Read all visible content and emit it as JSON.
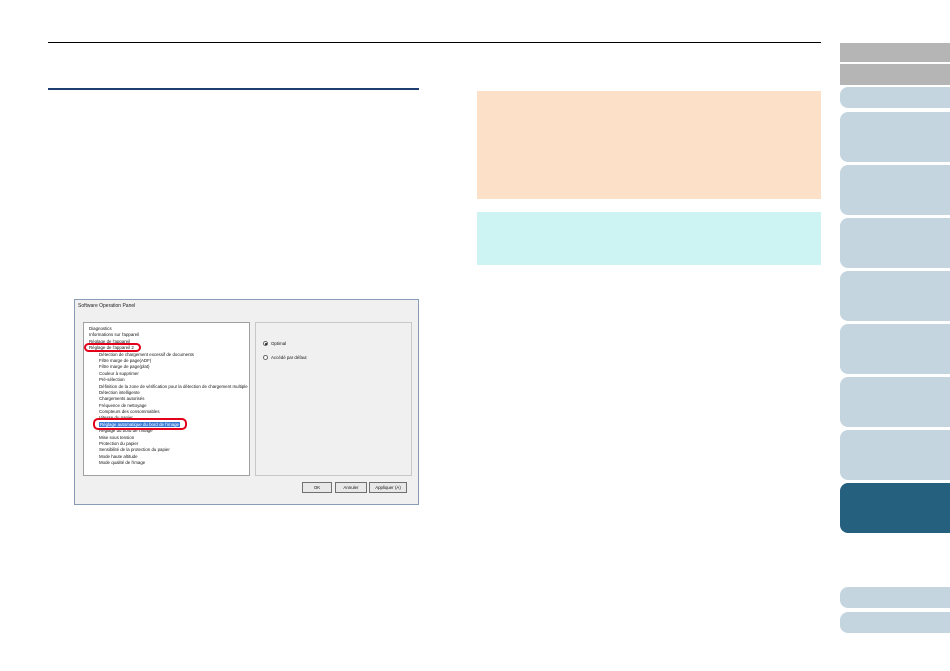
{
  "dialog": {
    "title": "Software Operation Panel",
    "tree": [
      {
        "label": "Diagnostics",
        "level": 0
      },
      {
        "label": "Informations sur l'appareil",
        "level": 0
      },
      {
        "label": "Réglage de l'appareil",
        "level": 0
      },
      {
        "label": "Réglage de l'appareil 2",
        "level": 0
      },
      {
        "label": "Détection de chargement excessif de documents",
        "level": 1
      },
      {
        "label": "Filtre marge de page(ADF)",
        "level": 1
      },
      {
        "label": "Filtre marge de page(plat)",
        "level": 1
      },
      {
        "label": "Couleur à supprimer",
        "level": 1
      },
      {
        "label": "Pré-sélection",
        "level": 1
      },
      {
        "label": "Définition de la zone de vérification pour la détection de chargement multiple",
        "level": 1
      },
      {
        "label": "Détection intelligente",
        "level": 1
      },
      {
        "label": "Chargements autorisés",
        "level": 1
      },
      {
        "label": "Fréquence de nettoyage",
        "level": 1
      },
      {
        "label": "Compteurs des consommables",
        "level": 1
      },
      {
        "label": "Vitesse du papier",
        "level": 1
      },
      {
        "label": "Réglage automatique du bord de l'image",
        "level": 1,
        "selected": true
      },
      {
        "label": "Réglage du bord de l'image",
        "level": 1
      },
      {
        "label": "Mise sous tension",
        "level": 1
      },
      {
        "label": "Protection du papier",
        "level": 1
      },
      {
        "label": "Sensibilité de la protection du papier",
        "level": 1
      },
      {
        "label": "Mode haute altitude",
        "level": 1
      },
      {
        "label": "Mode qualité de l'image",
        "level": 1
      }
    ],
    "options": [
      {
        "label": "Optimal",
        "checked": true
      },
      {
        "label": "Accédé par défaut",
        "checked": false
      }
    ],
    "buttons": {
      "ok": "OK",
      "cancel": "Annuler",
      "apply": "Appliquer (A)"
    }
  },
  "colors": {
    "rule_blue": "#1f3f73",
    "note_orange": "#fde0c8",
    "note_cyan": "#cdf3f3",
    "tab_light": "#c4d5e0",
    "tab_gray": "#b5b5b5",
    "tab_active": "#25607e",
    "highlight_red": "#e3001b"
  }
}
